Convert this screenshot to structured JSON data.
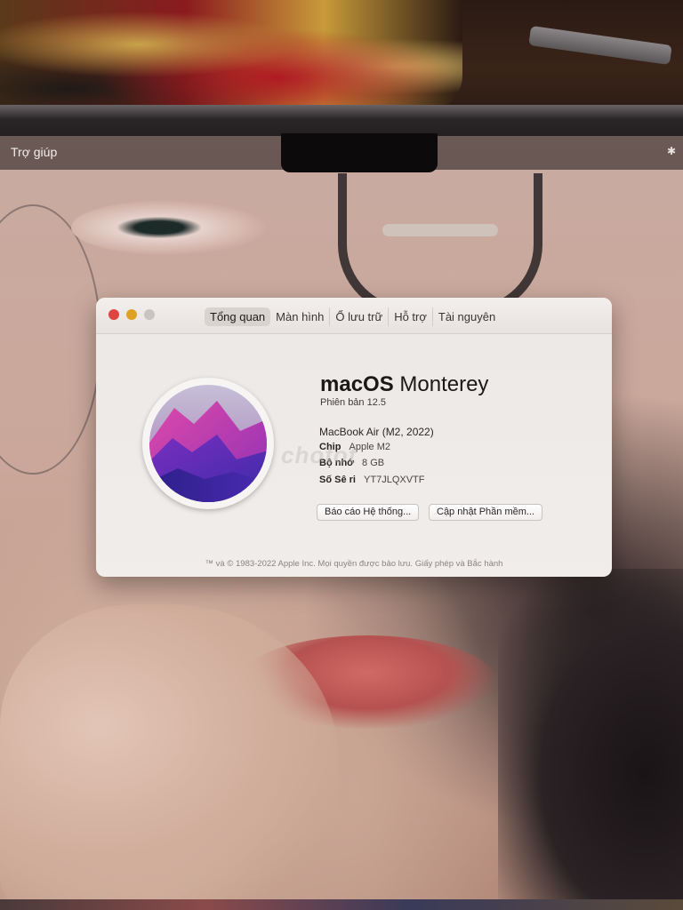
{
  "menubar": {
    "app_menu": "Trợ giúp",
    "status_icon": "bluetooth-icon"
  },
  "window": {
    "controls": [
      "close",
      "minimize",
      "zoom"
    ],
    "tabs": [
      {
        "label": "Tổng quan",
        "active": true
      },
      {
        "label": "Màn hình",
        "active": false
      },
      {
        "label": "Ổ lưu trữ",
        "active": false
      },
      {
        "label": "Hỗ trợ",
        "active": false
      },
      {
        "label": "Tài nguyên",
        "active": false
      }
    ],
    "os_name": "macOS",
    "os_codename": "Monterey",
    "version": "Phiên bản 12.5",
    "model": "MacBook Air (M2, 2022)",
    "specs": {
      "chip_label": "Chip",
      "chip_value": "Apple M2",
      "memory_label": "Bộ nhớ",
      "memory_value": "8 GB",
      "serial_label": "Số Sê ri",
      "serial_value": "YT7JLQXVTF"
    },
    "buttons": {
      "system_report": "Báo cáo Hệ thống...",
      "software_update": "Cập nhật Phần mềm..."
    },
    "footer": "™ và © 1983-2022 Apple Inc. Mọi quyền được bảo lưu. Giấy phép và Bắc hành",
    "watermark": "chotot"
  },
  "colors": {
    "close": "#e0443e",
    "minimize": "#dea123",
    "zoom": "#c9c4c2",
    "window_bg": "#ece8e6",
    "menubar_bg": "#786460"
  }
}
